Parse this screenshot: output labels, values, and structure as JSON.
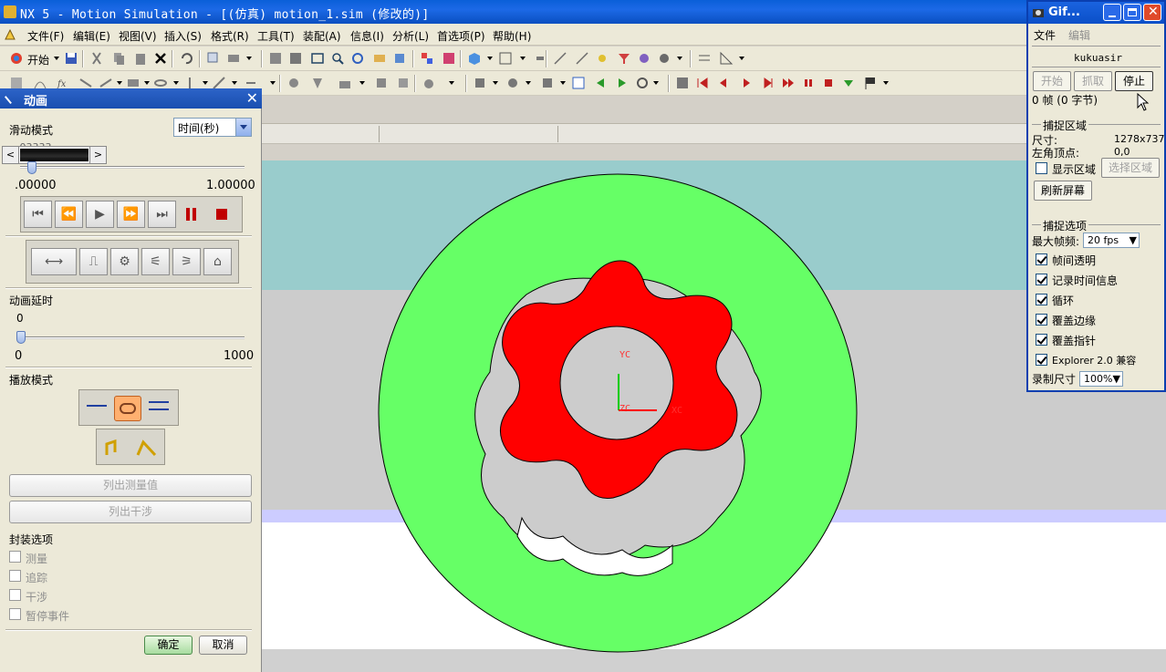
{
  "window": {
    "title": "NX 5 - Motion Simulation - [(仿真) motion_1.sim (修改的)]"
  },
  "menu": [
    "文件(F)",
    "编辑(E)",
    "视图(V)",
    "插入(S)",
    "格式(R)",
    "工具(T)",
    "装配(A)",
    "信息(I)",
    "分析(L)",
    "首选项(P)",
    "帮助(H)"
  ],
  "toolbar": {
    "start_label": "开始"
  },
  "panel": {
    "title": "动画",
    "slide_mode_label": "滑动模式",
    "slide_mode_value": "时间(秒)",
    "time_readout": ".03333",
    "time_min": ".00000",
    "time_max": "1.00000",
    "time_progress": 0.033,
    "delay_label": "动画延时",
    "delay_value": "0",
    "delay_min": "0",
    "delay_max": "1000",
    "playmode_label": "播放模式",
    "list_measure": "列出测量值",
    "list_interference": "列出干涉",
    "pkg_label": "封装选项",
    "pkg_items": [
      "测量",
      "追踪",
      "干涉",
      "暂停事件"
    ],
    "ok": "确定",
    "cancel": "取消"
  },
  "viewport": {
    "axis_yc": "YC",
    "axis_xc": "XC",
    "axis_zc": "ZC",
    "colors": {
      "outer_ring": "#66ff66",
      "gear": "#ff0000",
      "bg_top": "#99cccc",
      "bg_mid": "#cccccc",
      "bg_band": "#ccccff"
    }
  },
  "gif": {
    "title": "Gif...",
    "menu_file": "文件",
    "menu_edit": "编辑",
    "user": "kukuasir",
    "btn_start": "开始",
    "btn_capture": "抓取",
    "btn_stop": "停止",
    "frames": "0 帧 (0 字节)",
    "capture_area": "捕捉区域",
    "size_label": "尺寸:",
    "size_value": "1278x737",
    "topleft_label": "左角顶点:",
    "topleft_value": "0,0",
    "show_area": "显示区域",
    "select_area": "选择区域",
    "refresh": "刷新屏幕",
    "capture_opts": "捕捉选项",
    "max_fps_label": "最大帧频:",
    "max_fps_value": "20 fps",
    "opts": [
      "帧间透明",
      "记录时间信息",
      "循环",
      "覆盖边缘",
      "覆盖指针",
      "Explorer 2.0 兼容"
    ],
    "rec_size_label": "录制尺寸",
    "rec_size_value": "100%"
  }
}
